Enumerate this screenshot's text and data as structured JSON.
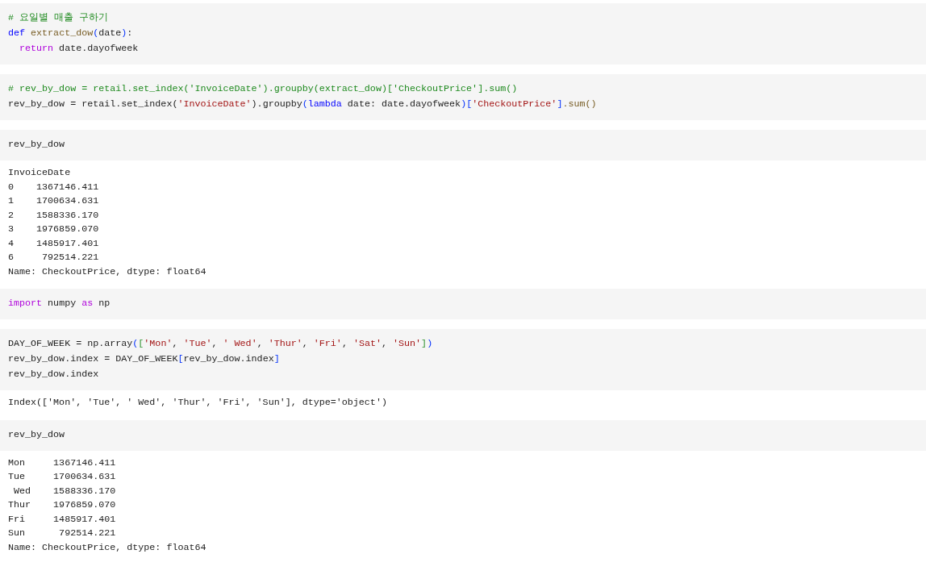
{
  "cells": [
    {
      "input": [
        [
          {
            "kind": "comment",
            "text": "# 요일별 매출 구하기"
          }
        ],
        [
          {
            "kind": "keyword",
            "text": "def"
          },
          {
            "kind": "function",
            "text": " extract_dow"
          },
          {
            "kind": "bracket1",
            "text": "("
          },
          {
            "kind": "plain",
            "text": "date"
          },
          {
            "kind": "bracket1",
            "text": ")"
          },
          {
            "kind": "plain",
            "text": ":"
          }
        ],
        [
          {
            "kind": "control",
            "text": "  return"
          },
          {
            "kind": "plain",
            "text": " date.dayofweek"
          }
        ]
      ]
    },
    {
      "input": [
        [
          {
            "kind": "comment",
            "text": "# rev_by_dow = retail.set_index('InvoiceDate').groupby(extract_dow)['CheckoutPrice'].sum()"
          }
        ],
        [
          {
            "kind": "plain",
            "text": "rev_by_dow = retail.set_index("
          },
          {
            "kind": "string",
            "text": "'InvoiceDate'"
          },
          {
            "kind": "plain",
            "text": ").groupby"
          },
          {
            "kind": "bracket1",
            "text": "("
          },
          {
            "kind": "keyword",
            "text": "lambda"
          },
          {
            "kind": "plain",
            "text": " date: date.dayofweek"
          },
          {
            "kind": "bracket1",
            "text": ")["
          },
          {
            "kind": "string",
            "text": "'CheckoutPrice'"
          },
          {
            "kind": "bracket1",
            "text": "]"
          },
          {
            "kind": "function",
            "text": ".sum()"
          }
        ]
      ]
    },
    {
      "input": [
        [
          {
            "kind": "plain",
            "text": "rev_by_dow"
          }
        ]
      ],
      "output": [
        "InvoiceDate",
        "0    1367146.411",
        "1    1700634.631",
        "2    1588336.170",
        "3    1976859.070",
        "4    1485917.401",
        "6     792514.221",
        "Name: CheckoutPrice, dtype: float64"
      ]
    },
    {
      "input": [
        [
          {
            "kind": "control",
            "text": "import"
          },
          {
            "kind": "plain",
            "text": " numpy "
          },
          {
            "kind": "control",
            "text": "as"
          },
          {
            "kind": "plain",
            "text": " np"
          }
        ]
      ]
    },
    {
      "input": [
        [
          {
            "kind": "plain",
            "text": "DAY_OF_WEEK = np.array"
          },
          {
            "kind": "bracket1",
            "text": "("
          },
          {
            "kind": "bracket2",
            "text": "["
          },
          {
            "kind": "string",
            "text": "'Mon'"
          },
          {
            "kind": "plain",
            "text": ", "
          },
          {
            "kind": "string",
            "text": "'Tue'"
          },
          {
            "kind": "plain",
            "text": ", "
          },
          {
            "kind": "string",
            "text": "' Wed'"
          },
          {
            "kind": "plain",
            "text": ", "
          },
          {
            "kind": "string",
            "text": "'Thur'"
          },
          {
            "kind": "plain",
            "text": ", "
          },
          {
            "kind": "string",
            "text": "'Fri'"
          },
          {
            "kind": "plain",
            "text": ", "
          },
          {
            "kind": "string",
            "text": "'Sat'"
          },
          {
            "kind": "plain",
            "text": ", "
          },
          {
            "kind": "string",
            "text": "'Sun'"
          },
          {
            "kind": "bracket2",
            "text": "]"
          },
          {
            "kind": "bracket1",
            "text": ")"
          }
        ],
        [
          {
            "kind": "plain",
            "text": "rev_by_dow.index = DAY_OF_WEEK"
          },
          {
            "kind": "bracket1",
            "text": "["
          },
          {
            "kind": "plain",
            "text": "rev_by_dow.index"
          },
          {
            "kind": "bracket1",
            "text": "]"
          }
        ],
        [
          {
            "kind": "plain",
            "text": "rev_by_dow.index"
          }
        ]
      ],
      "output": [
        "Index(['Mon', 'Tue', ' Wed', 'Thur', 'Fri', 'Sun'], dtype='object')"
      ]
    },
    {
      "input": [
        [
          {
            "kind": "plain",
            "text": "rev_by_dow"
          }
        ]
      ],
      "output": [
        "Mon     1367146.411",
        "Tue     1700634.631",
        " Wed    1588336.170",
        "Thur    1976859.070",
        "Fri     1485917.401",
        "Sun      792514.221",
        "Name: CheckoutPrice, dtype: float64"
      ]
    }
  ]
}
